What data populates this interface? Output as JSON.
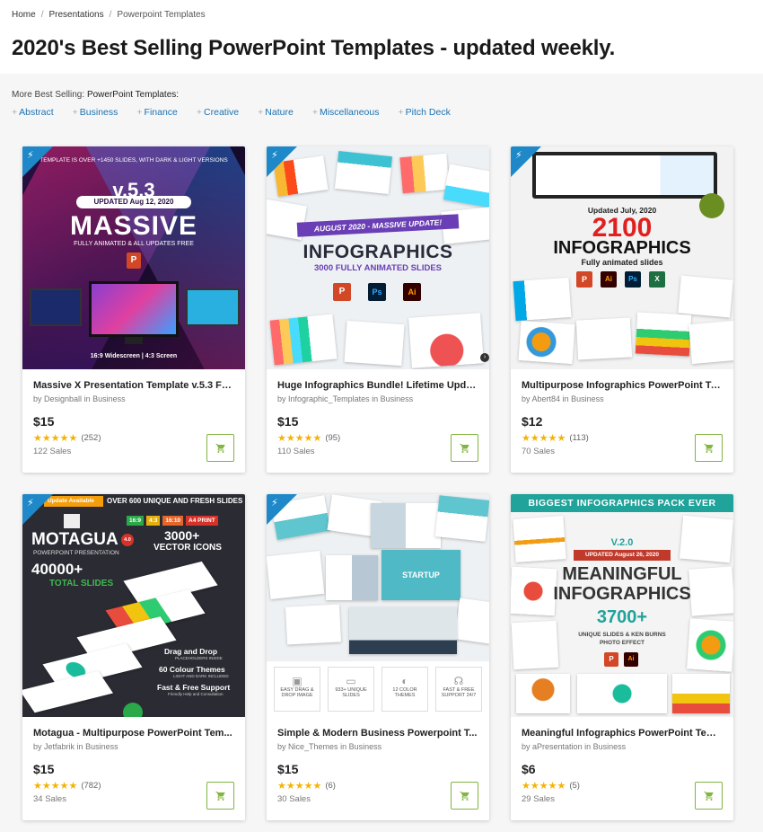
{
  "breadcrumb": {
    "items": [
      "Home",
      "Presentations",
      "Powerpoint Templates"
    ]
  },
  "page_title": "2020's Best Selling PowerPoint Templates - updated weekly.",
  "filters": {
    "prefix": "More Best Selling:",
    "category": "PowerPoint Templates:",
    "links": [
      "Abstract",
      "Business",
      "Finance",
      "Creative",
      "Nature",
      "Miscellaneous",
      "Pitch Deck"
    ]
  },
  "products": [
    {
      "name": "Massive X Presentation Template v.5.3 Fu...",
      "by": "by",
      "author": "Designball",
      "in": "in",
      "category": "Business",
      "price": "$15",
      "reviews": "(252)",
      "sales": "122 Sales",
      "rating": 5,
      "thumb": {
        "top_banner": "TEMPLATE IS OVER +1450 SLIDES, WITH DARK & LIGHT VERSIONS",
        "version": "v.5.3",
        "updated": "UPDATED Aug 12, 2020",
        "headline": "MASSIVE",
        "sub": "FULLY ANIMATED & ALL UPDATES FREE",
        "footer": "16:9 Widescreen | 4:3 Screen",
        "bg": "#1a1030"
      }
    },
    {
      "name": "Huge Infographics Bundle! Lifetime Upda...",
      "by": "by",
      "author": "Infographic_Templates",
      "in": "in",
      "category": "Business",
      "price": "$15",
      "reviews": "(95)",
      "sales": "110 Sales",
      "rating": 5,
      "thumb": {
        "ribbon": "AUGUST 2020 - MASSIVE UPDATE!",
        "headline": "INFOGRAPHICS",
        "sub": "3000 FULLY ANIMATED SLIDES",
        "apps": [
          "P",
          "Ps",
          "Ai"
        ]
      }
    },
    {
      "name": "Multipurpose Infographics PowerPoint Te...",
      "by": "by",
      "author": "Abert84",
      "in": "in",
      "category": "Business",
      "price": "$12",
      "reviews": "(113)",
      "sales": "70 Sales",
      "rating": 5,
      "thumb": {
        "updated": "Updated July, 2020",
        "number": "2100",
        "headline": "INFOGRAPHICS",
        "sub": "Fully animated slides",
        "apps": [
          "P",
          "Ai",
          "Ps",
          "X"
        ]
      }
    },
    {
      "name": "Motagua - Multipurpose PowerPoint Tem...",
      "by": "by",
      "author": "Jetfabrik",
      "in": "in",
      "category": "Business",
      "price": "$15",
      "reviews": "(782)",
      "sales": "34 Sales",
      "rating": 5,
      "thumb": {
        "update": "Update Available",
        "top": "OVER 600 UNIQUE AND FRESH SLIDES",
        "ratios": [
          "16:9",
          "4:3",
          "16:10",
          "A4 PRINT"
        ],
        "headline": "MOTAGUA",
        "version": "4.0",
        "sub": "POWERPOINT PRESENTATION",
        "icons": "3000+",
        "icons_label": "VECTOR ICONS",
        "slides": "40000+",
        "slides_label": "TOTAL SLIDES",
        "feat1": "Drag and Drop",
        "feat1b": "PLACEHOLDERS INSIDE",
        "feat2": "60 Colour Themes",
        "feat2b": "LIGHT AND DARK INCLUDED",
        "feat3": "Fast & Free Support",
        "feat3b": "Friendly Help and Consultation"
      }
    },
    {
      "name": "Simple & Modern Business Powerpoint T...",
      "by": "by",
      "author": "Nice_Themes",
      "in": "in",
      "category": "Business",
      "price": "$15",
      "reviews": "(6)",
      "sales": "30 Sales",
      "rating": 5,
      "thumb": {
        "startup": "STARTUP",
        "feats": [
          "EASY DRAG & DROP IMAGE",
          "933+ UNIQUE SLIDES",
          "12 COLOR THEMES",
          "FAST & FREE SUPPORT 24/7"
        ]
      }
    },
    {
      "name": "Meaningful Infographics PowerPoint Tem...",
      "by": "by",
      "author": "aPresentation",
      "in": "in",
      "category": "Business",
      "price": "$6",
      "reviews": "(5)",
      "sales": "29 Sales",
      "rating": 5,
      "thumb": {
        "banner": "BIGGEST INFOGRAPHICS PACK EVER",
        "version": "V.2.0",
        "updated": "UPDATED August 26, 2020",
        "headline1": "MEANINGFUL",
        "headline2": "INFOGRAPHICS",
        "number": "3700+",
        "sub": "UNIQUE SLIDES & KEN BURNS PHOTO EFFECT"
      }
    }
  ],
  "colors": {
    "link": "#1b73b3",
    "cart_border": "#82b541",
    "star": "#f5b301",
    "flag": "#1e88c8"
  }
}
